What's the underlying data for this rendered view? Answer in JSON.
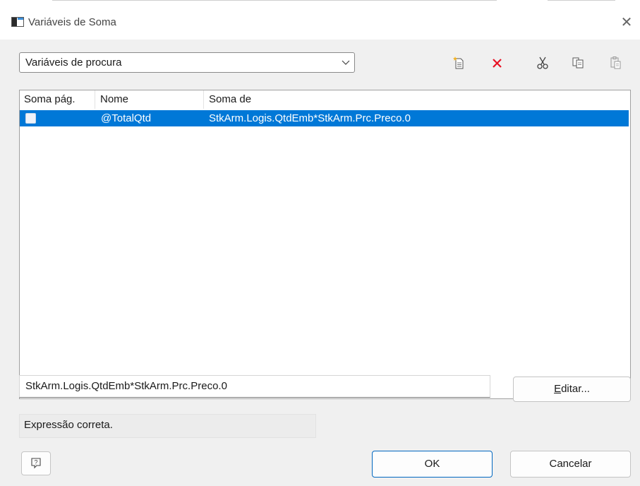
{
  "window": {
    "title": "Variáveis de Soma",
    "close_icon": "close-icon"
  },
  "search": {
    "selected": "Variáveis de procura"
  },
  "toolbar": {
    "items": [
      "new-icon",
      "delete-icon",
      "cut-icon",
      "copy-icon",
      "paste-icon"
    ],
    "delete_color": "#e81123"
  },
  "table": {
    "columns": [
      "Soma pág.",
      "Nome",
      "Soma de"
    ],
    "rows": [
      {
        "soma_pag": false,
        "nome": "@TotalQtd",
        "soma_de": "StkArm.Logis.QtdEmb*StkArm.Prc.Preco.0"
      }
    ],
    "selection_color": "#0078d7"
  },
  "expression": {
    "value": "StkArm.Logis.QtdEmb*StkArm.Prc.Preco.0"
  },
  "buttons": {
    "edit_prefix": "E",
    "edit_rest": "ditar...",
    "ok": "OK",
    "cancel": "Cancelar",
    "help_icon": "help-icon"
  },
  "status": {
    "message": "Expressão correta."
  }
}
